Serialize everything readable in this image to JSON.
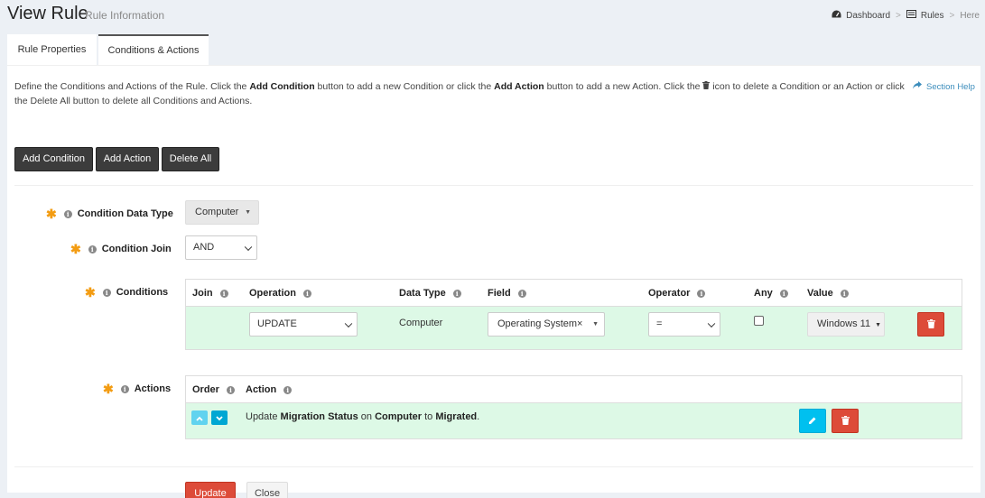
{
  "header": {
    "title": "View Rule",
    "subtitle": "Rule Information",
    "breadcrumb": [
      {
        "label": "Dashboard",
        "icon": "dashboard-icon"
      },
      {
        "label": "Rules",
        "icon": "list-icon"
      },
      {
        "label": "Here"
      }
    ]
  },
  "tabs": [
    {
      "label": "Rule Properties",
      "active": false
    },
    {
      "label": "Conditions & Actions",
      "active": true
    }
  ],
  "description": {
    "p1": "Define the Conditions and Actions of the Rule. Click the ",
    "b1": "Add Condition",
    "p2": " button to add a new Condition or click the ",
    "b2": "Add Action",
    "p3": " button to add a new Action. Click the ",
    "p4": " icon to delete a Condition or an Action or click the Delete All button to delete all Conditions and Actions.",
    "help_label": "Section Help"
  },
  "toolbar": {
    "add_condition": "Add Condition",
    "add_action": "Add Action",
    "delete_all": "Delete All"
  },
  "form": {
    "condition_data_type": {
      "label": "Condition Data Type",
      "value": "Computer"
    },
    "condition_join": {
      "label": "Condition Join",
      "value": "AND"
    },
    "conditions_label": "Conditions",
    "actions_label": "Actions"
  },
  "conditions": {
    "headers": {
      "join": "Join",
      "operation": "Operation",
      "data_type": "Data Type",
      "field": "Field",
      "operator": "Operator",
      "any": "Any",
      "value": "Value"
    },
    "rows": [
      {
        "join": "",
        "operation": "UPDATE",
        "data_type": "Computer",
        "field": "Operating System",
        "operator": "=",
        "any": false,
        "value": "Windows 11"
      }
    ]
  },
  "actions": {
    "headers": {
      "order": "Order",
      "action": "Action"
    },
    "rows": [
      {
        "prefix": "Update ",
        "field": "Migration Status",
        "mid1": " on ",
        "target": "Computer",
        "mid2": " to ",
        "value": "Migrated",
        "suffix": "."
      }
    ]
  },
  "footer": {
    "update": "Update",
    "close": "Close"
  },
  "colors": {
    "row_green": "#ddf9e6",
    "danger": "#dd4b39",
    "info": "#00c0ef",
    "required": "#f39c12",
    "link": "#3c8dbc"
  }
}
